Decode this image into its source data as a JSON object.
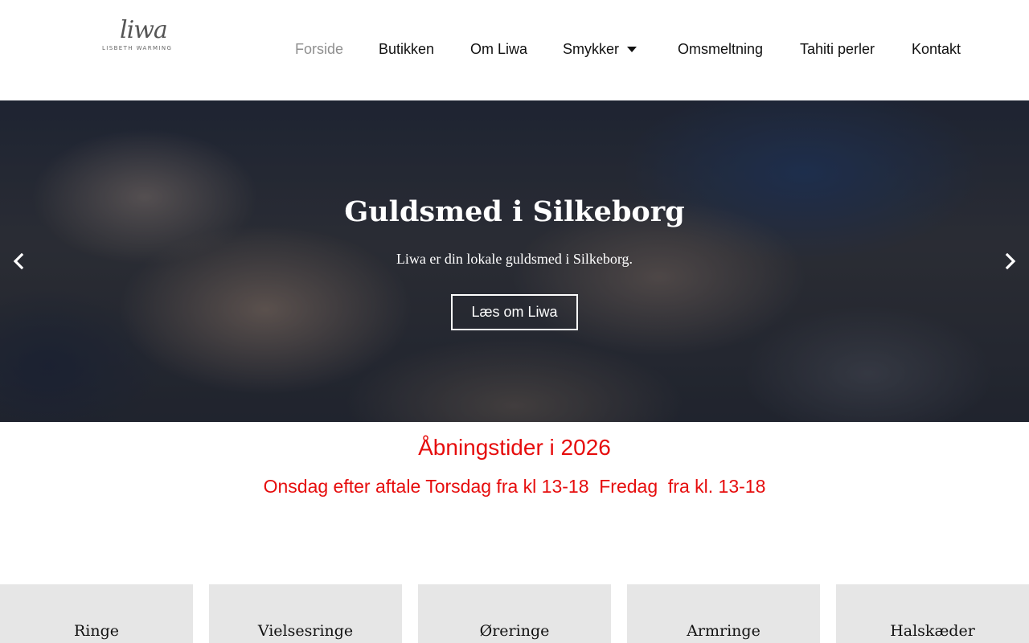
{
  "logo": {
    "script": "liwa",
    "sub": "LISBETH WARMING"
  },
  "nav": {
    "items": [
      {
        "label": "Forside",
        "active": true
      },
      {
        "label": "Butikken"
      },
      {
        "label": "Om Liwa"
      },
      {
        "label": "Smykker",
        "has_dropdown": true
      },
      {
        "label": "Omsmeltning"
      },
      {
        "label": "Tahiti perler"
      },
      {
        "label": "Kontakt"
      }
    ]
  },
  "hero": {
    "title": "Guldsmed i Silkeborg",
    "subtitle": "Liwa er din lokale guldsmed i Silkeborg.",
    "button_label": "Læs om Liwa",
    "prev_icon": "chevron-left-icon",
    "next_icon": "chevron-right-icon"
  },
  "hours": {
    "title": "Åbningstider i 2026",
    "line": "Onsdag efter aftale Torsdag fra kl 13-18  Fredag  fra kl. 13-18"
  },
  "categories": [
    {
      "label": "Ringe"
    },
    {
      "label": "Vielsesringe"
    },
    {
      "label": "Øreringe"
    },
    {
      "label": "Armringe"
    },
    {
      "label": "Halskæder"
    }
  ],
  "colors": {
    "accent_red": "#e60d0d",
    "nav_active": "#8f8f8f",
    "category_bg": "#e6e6e6"
  }
}
